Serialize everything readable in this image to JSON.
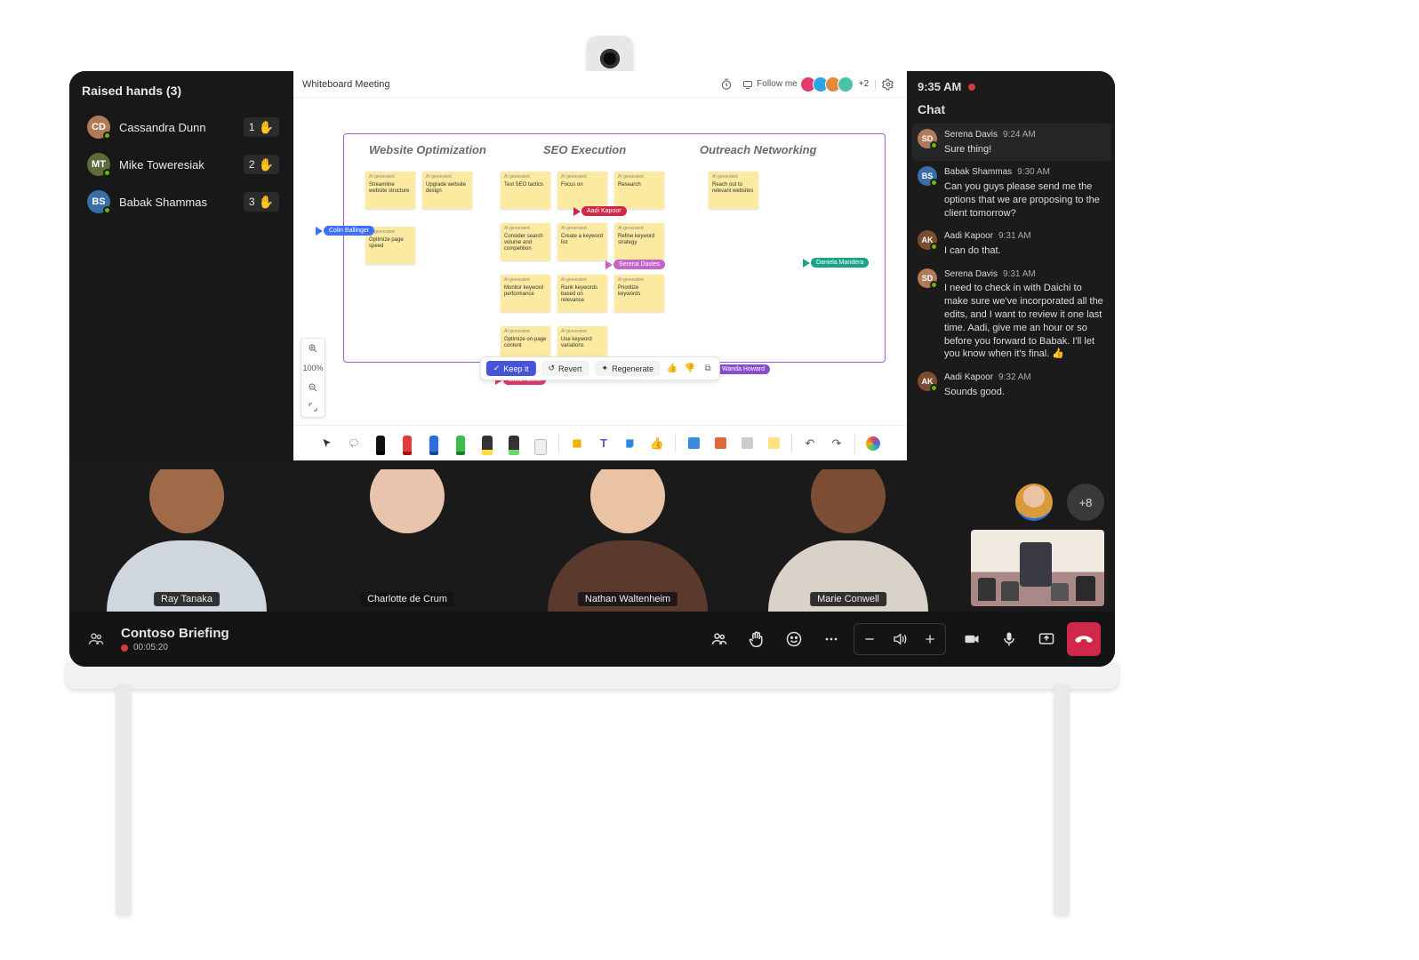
{
  "raised_hands": {
    "title": "Raised hands (3)",
    "items": [
      {
        "name": "Cassandra Dunn",
        "order": "1",
        "avatar_color": "#b07a56"
      },
      {
        "name": "Mike Toweresiak",
        "order": "2",
        "avatar_color": "#5b6b3a"
      },
      {
        "name": "Babak Shammas",
        "order": "3",
        "avatar_color": "#3a6ea8"
      }
    ]
  },
  "whiteboard": {
    "title": "Whiteboard Meeting",
    "follow_label": "Follow me",
    "overflow_count": "+2",
    "avatar_colors": [
      "#e23b6a",
      "#2aa6e0",
      "#e2893b",
      "#49c2a7"
    ],
    "column_titles": [
      "Website Optimization",
      "SEO Execution",
      "Outreach Networking"
    ],
    "stickies": {
      "c1": [
        [
          "Streamline website structure",
          "Upgrade website design"
        ],
        [
          "Optimize page speed"
        ]
      ],
      "c2": [
        [
          "Test SEO tactics",
          "Focus on",
          "Research"
        ],
        [
          "Consider search volume and competition",
          "Create a keyword list",
          "Refine keyword strategy"
        ],
        [
          "Monitor keyword performance",
          "Rank keywords based on relevance",
          "Prioritize keywords"
        ],
        [
          "Optimize on-page content",
          "Use keyword variations"
        ]
      ],
      "c3": [
        [
          "Reach out to relevant websites"
        ]
      ]
    },
    "cursors": [
      {
        "name": "Colin Ballinger",
        "color": "#3f6fff"
      },
      {
        "name": "Aadi Kapoor",
        "color": "#d0274a"
      },
      {
        "name": "Serena Davies",
        "color": "#c465c9"
      },
      {
        "name": "Elvia Atkins",
        "color": "#e23b6a"
      },
      {
        "name": "Wanda Howard",
        "color": "#8a4dd0"
      },
      {
        "name": "Daniela Mandera",
        "color": "#1aa387"
      }
    ],
    "zoom_label": "100%",
    "actions": {
      "keep": "Keep it",
      "revert": "Revert",
      "regen": "Regenerate"
    }
  },
  "clock": "9:35 AM",
  "chat": {
    "title": "Chat",
    "messages": [
      {
        "name": "Serena Davis",
        "time": "9:24 AM",
        "text": "Sure thing!",
        "color": "#b07a56"
      },
      {
        "name": "Babak Shammas",
        "time": "9:30 AM",
        "text": "Can you guys please send me the options that we are proposing to the client tomorrow?",
        "color": "#3a6ea8"
      },
      {
        "name": "Aadi Kapoor",
        "time": "9:31 AM",
        "text": "I can do that.",
        "color": "#7a4d2e"
      },
      {
        "name": "Serena Davis",
        "time": "9:31 AM",
        "text": "I need to check in with Daichi to make sure we've incorporated all the edits, and I want to review it one last time. Aadi, give me an hour or so before you forward to Babak. I'll let you know when it's final. 👍",
        "color": "#b07a56"
      },
      {
        "name": "Aadi Kapoor",
        "time": "9:32 AM",
        "text": "Sounds good.",
        "color": "#7a4d2e"
      }
    ]
  },
  "participants": [
    {
      "name": "Ray Tanaka",
      "skin": "#a06a48",
      "shirt": "#cfd6de"
    },
    {
      "name": "Charlotte de Crum",
      "skin": "#e8c4ad",
      "shirt": "#1a1a1a"
    },
    {
      "name": "Nathan Waltenheim",
      "skin": "#e9c3a4",
      "shirt": "#5a3a2c"
    },
    {
      "name": "Marie Conwell",
      "skin": "#7a4d34",
      "shirt": "#d8d2c8"
    }
  ],
  "overflow_participants": "+8",
  "meeting": {
    "title": "Contoso Briefing",
    "elapsed": "00:05:20"
  }
}
